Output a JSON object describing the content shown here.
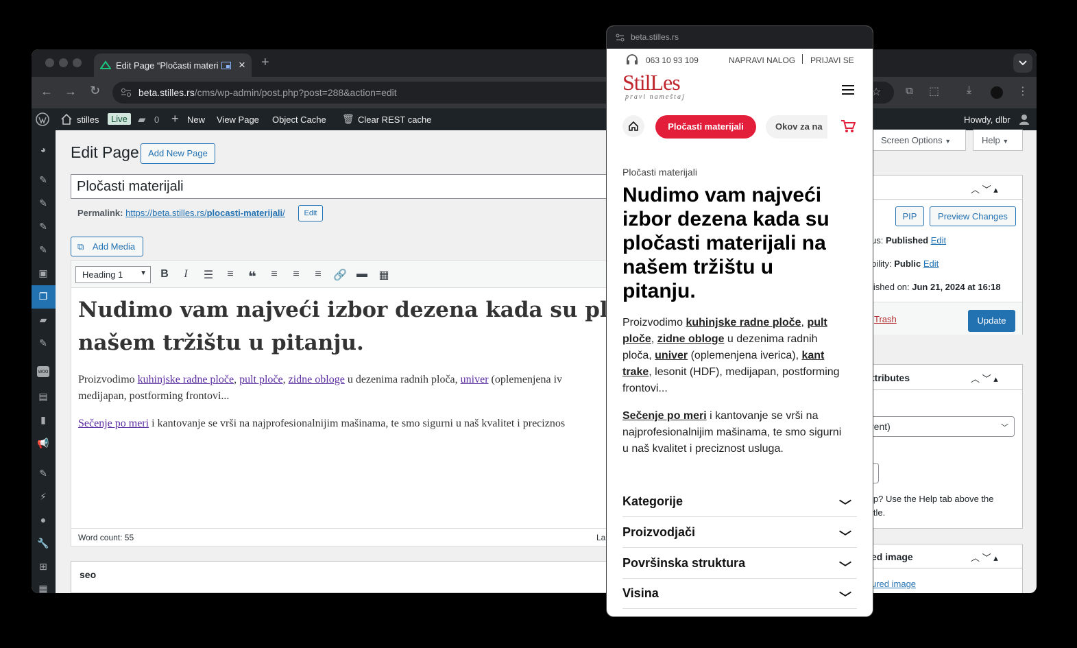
{
  "browser": {
    "tab_title": "Edit Page “Pločasti materi",
    "url_host": "beta.stilles.rs",
    "url_path": "/cms/wp-admin/post.php?post=288&action=edit"
  },
  "adminbar": {
    "site": "stilles",
    "live": "Live",
    "comments": "0",
    "new": "New",
    "view_page": "View Page",
    "object_cache": "Object Cache",
    "clear_rest": "Clear REST cache",
    "howdy": "Howdy, dlbr"
  },
  "page": {
    "heading": "Edit Page",
    "add_new": "Add New Page",
    "title_value": "Pločasti materijali",
    "permalink_label": "Permalink:",
    "permalink_base": "https://beta.stilles.rs/",
    "permalink_slug": "plocasti-materijali",
    "permalink_end": "/",
    "permalink_edit": "Edit",
    "add_media": "Add Media",
    "format": "Heading 1",
    "content_h1_line1": "Nudimo vam najveći izbor dezena kada su ploča",
    "content_h1_line2": "našem tržištu u pitanju.",
    "p1_pre": "Proizvodimo ",
    "p1_link1": "kuhinjske radne ploče",
    "p1_sep1": ", ",
    "p1_link2": "pult ploče",
    "p1_sep2": ", ",
    "p1_link3": "zidne obloge",
    "p1_mid": " u dezenima radnih ploča, ",
    "p1_link4": "univer",
    "p1_end": " (oplemenjena iv",
    "p1_line2": "medijapan, postforming frontovi...",
    "p2_link": "Sečenje po meri",
    "p2_text": " i kantovanje se vrši na najprofesionalnijim mašinama, te smo sigurni u naš kvalitet i preciznos",
    "word_count": "Word count: 55",
    "last_edit": "La",
    "seo_box": "seo"
  },
  "right": {
    "screen_options": "Screen Options",
    "help": "Help",
    "pip": "PIP",
    "preview": "Preview Changes",
    "status_lbl": "us: ",
    "status_val": "Published",
    "visibility_lbl": "bility: ",
    "visibility_val": "Public",
    "edit": "Edit",
    "published_lbl": "lished on: ",
    "published_val": "Jun 21, 2024 at 16:18",
    "trash": "Trash",
    "update": "Update",
    "attributes": "ttributes",
    "parent": "rent)",
    "help_text1": "lp? Use the Help tab above the",
    "help_text2": "itle.",
    "featured": "ed image",
    "featured_link": "ured image"
  },
  "popup": {
    "url": "beta.stilles.rs",
    "phone": "063 10 93 109",
    "napravi": "NAPRAVI NALOG",
    "prijavi": "PRIJAVI SE",
    "logo": "StilLes",
    "logo_tag": "pravi nameštaj",
    "pill_active": "Pločasti materijali",
    "pill_next": "Okov za na",
    "breadcrumb": "Pločasti materijali",
    "h1_lines": [
      "Nudimo vam najveći",
      "izbor dezena kada su",
      "pločasti materijali na",
      "našem tržištu u",
      "pitanju."
    ],
    "p1_l1_pre": "Proizvodimo ",
    "p1_l1_link1": "kuhinjske radne ploče",
    "p1_l1_sep": ", ",
    "p1_l1_link2": "pult",
    "p1_l2_link1": "ploče",
    "p1_l2_sep": ", ",
    "p1_l2_link2": "zidne obloge",
    "p1_l2_rest": " u dezenima radnih",
    "p1_l3_pre": "ploča, ",
    "p1_l3_link": "univer",
    "p1_l3_mid": " (oplemenjena iverica), ",
    "p1_l3_link2": "kant",
    "p1_l4_link": "trake",
    "p1_l4_rest": ", lesonit (HDF), medijapan, postforming",
    "p1_l5": "frontovi...",
    "p2_l1_link": "Sečenje po meri",
    "p2_l1_rest": " i kantovanje se vrši na",
    "p2_l2": "najprofesionalnijim mašinama, te smo sigurni",
    "p2_l3": "u naš kvalitet i preciznost usluga.",
    "accordions": [
      "Kategorije",
      "Proizvodjači",
      "Površinska struktura",
      "Visina"
    ]
  },
  "colors": {
    "wp_blue": "#2271b1",
    "stilles_red": "#e31e3b",
    "admin_dark": "#1d2327"
  }
}
